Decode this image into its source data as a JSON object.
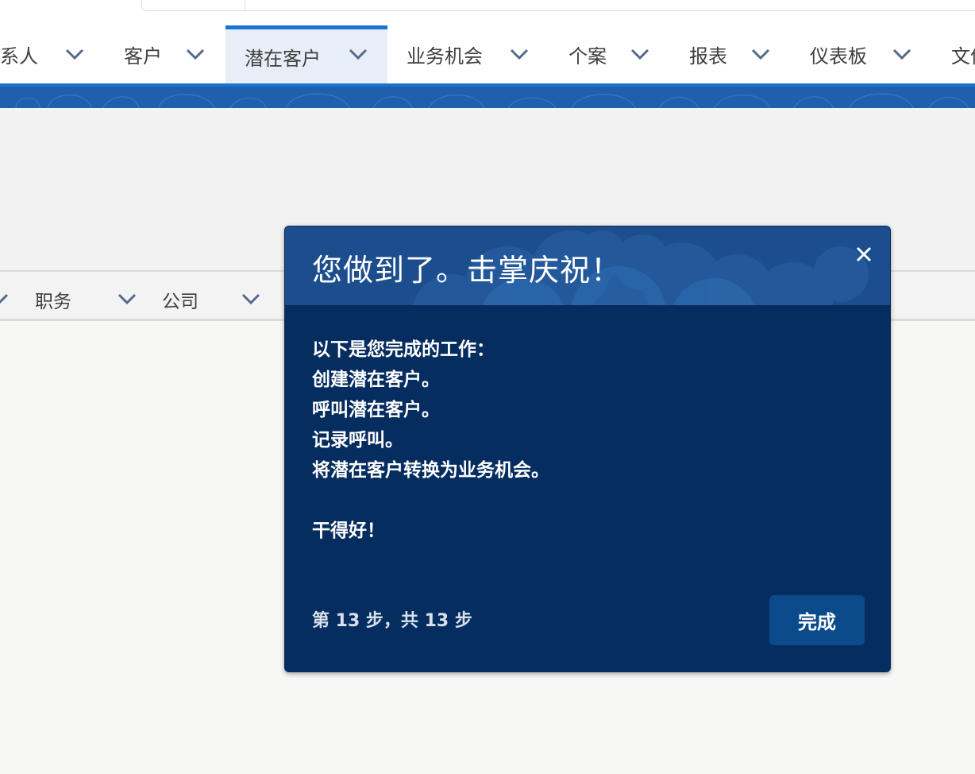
{
  "nav": {
    "items": [
      {
        "label": "联系人",
        "active": false
      },
      {
        "label": "客户",
        "active": false
      },
      {
        "label": "潜在客户",
        "active": true
      },
      {
        "label": "业务机会",
        "active": false
      },
      {
        "label": "个案",
        "active": false
      },
      {
        "label": "报表",
        "active": false
      },
      {
        "label": "仪表板",
        "active": false
      },
      {
        "label": "文件",
        "active": false
      }
    ]
  },
  "columns": [
    {
      "label": "职务"
    },
    {
      "label": "公司"
    }
  ],
  "popup": {
    "title": "您做到了。击掌庆祝！",
    "lines": [
      "以下是您完成的工作：",
      "创建潜在客户。",
      "呼叫潜在客户。",
      "记录呼叫。",
      "将潜在客户转换为业务机会。"
    ],
    "closing": "干得好！",
    "step": "第 13 步，共 13 步",
    "done_label": "完成",
    "close_icon": "close-icon"
  },
  "colors": {
    "accent": "#1b73d0",
    "popup_bg": "#062d5f",
    "popup_header_bg": "#1c4d8c",
    "done_button_bg": "#0b4a8b"
  }
}
